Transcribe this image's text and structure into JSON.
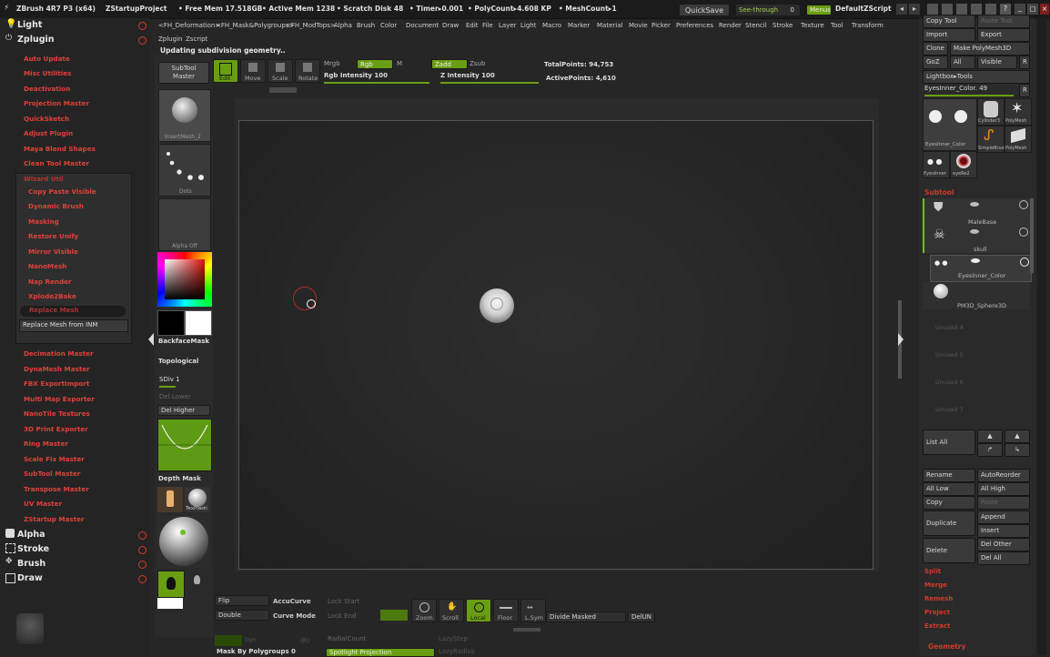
{
  "titlebar": {
    "app": "ZBrush 4R7 P3 (x64)",
    "project": "ZStartupProject",
    "free_mem": "• Free Mem 17.518GB",
    "active_mem": "• Active Mem 1238",
    "scratch": "• Scratch Disk 48",
    "timer": "• Timer▸0.001",
    "polycount": "• PolyCount▸4.608 KP",
    "meshcount": "• MeshCount▸1",
    "quicksave": "QuickSave",
    "seethrough": "See-through",
    "seethrough_val": "0",
    "menus": "Menus",
    "defaultzscript": "DefaultZScript"
  },
  "menubar": [
    "<FH_Deformation>",
    "<FH_Mask&Polygroups>",
    "<FH_ModTops>",
    "Alpha",
    "Brush",
    "Color",
    "Document",
    "Draw",
    "Edit",
    "File",
    "Layer",
    "Light",
    "Macro",
    "Marker",
    "Material",
    "Movie",
    "Picker",
    "Preferences",
    "Render",
    "Stencil",
    "Stroke",
    "Texture",
    "Tool",
    "Transform"
  ],
  "submenubar": [
    "Zplugin",
    "Zscript"
  ],
  "status": "Updating subdivision geometry..",
  "left_panel": {
    "light": "Light",
    "zplugin": "Zplugin",
    "plugins_top": [
      "Auto Update",
      "Misc Utilities",
      "Deactivation",
      "Projection Master",
      "QuickSketch",
      "Adjust Plugin",
      "Maya Blend Shapes",
      "Clean Tool Master"
    ],
    "wizard": "Wizard Util",
    "wizard_items": [
      "Copy Paste Visible",
      "Dynamic Brush",
      "Masking",
      "Restore Unify",
      "Mirror Visible",
      "NanoMesh",
      "Nap Render",
      "Xplode2Bake",
      "Replace Mesh"
    ],
    "replace_mesh_inm": "Replace Mesh from INM",
    "plugins_bottom": [
      "Decimation Master",
      "DynaMesh Master",
      "FBX ExportImport",
      "Multi Map Exporter",
      "NanoTile Textures",
      "3D Print Exporter",
      "Ring Master",
      "Scale Fix Master",
      "SubTool Master",
      "Transpose Master",
      "UV Master",
      "ZStartup Master"
    ],
    "alpha": "Alpha",
    "stroke": "Stroke",
    "brush": "Brush",
    "draw": "Draw"
  },
  "shelf": {
    "subtool_master": [
      "SubTool",
      "Master"
    ],
    "edit": "Edit",
    "move": "Move",
    "scale": "Scale",
    "rotate": "Rotate",
    "mrgb": "Mrgb",
    "rgb": "Rgb",
    "m": "M",
    "zadd": "Zadd",
    "zsub": "Zsub",
    "rgb_intensity": "Rgb Intensity 100",
    "z_intensity": "Z Intensity 100",
    "total_points": "TotalPoints: 94,753",
    "active_points": "ActivePoints: 4,610"
  },
  "left_tray": {
    "brush_label": "InsertMesh_2",
    "stroke_label": "Dots",
    "alpha_label": "Alpha Off",
    "backface": "BackfaceMask",
    "topological": "Topological",
    "sdiv": "SDiv 1",
    "del_lower": "Del Lower",
    "del_higher": "Del Higher",
    "depth_mask": "Depth Mask",
    "texture_label": "TexPlasti"
  },
  "bottom_bar": {
    "flip": "Flip",
    "double": "Double",
    "accucurve": "AccuCurve",
    "curve_mode": "Curve Mode",
    "lock_start": "Lock Start",
    "lock_end": "Lock End",
    "zoom": "Zoom",
    "scroll": "Scroll",
    "local": "Local",
    "floor": "Floor",
    "lsym": "L.Sym",
    "divide_masked": "Divide Masked",
    "delun": "DelUN",
    "radialcount": "RadialCount",
    "lazystep": "LazyStep",
    "mask_by_polygroups": "Mask By Polygroups 0",
    "spotlight": "Spotlight Projection",
    "lazyradius": "LazyRadius",
    "dyn": "Dyn",
    "r": "(R)"
  },
  "right_panel": {
    "copy_tool": "Copy Tool",
    "paste_tool": "Paste Tool",
    "import": "Import",
    "export": "Export",
    "clone": "Clone",
    "make_polymesh": "Make PolyMesh3D",
    "goz": "GoZ",
    "all": "All",
    "visible": "Visible",
    "r": "R",
    "lightbox_tools": "Lightbox▸Tools",
    "current_tool": "EyesInner_Color. 49",
    "tool_thumbs": [
      "EyesInner_Color",
      "Cylinder3",
      "PolyMesh",
      "SimpleBrush",
      "PolyMesh",
      "EyesInner",
      "eyeRe2"
    ],
    "subtool_header": "Subtool",
    "subtools": [
      "MaleBase",
      "skull",
      "EyesInner_Color",
      "PM3D_Sphere3D",
      "Unused 4",
      "Unused 5",
      "Unused 6",
      "Unused 7"
    ],
    "list_all": "List All",
    "rename": "Rename",
    "autoreorder": "AutoReorder",
    "all_low": "All Low",
    "all_high": "All High",
    "copy": "Copy",
    "paste": "Paste",
    "duplicate": "Duplicate",
    "append": "Append",
    "insert": "Insert",
    "delete": "Delete",
    "del_other": "Del Other",
    "del_all": "Del All",
    "split": "Split",
    "merge": "Merge",
    "remesh": "Remesh",
    "project": "Project",
    "extract": "Extract",
    "geometry": "Geometry"
  },
  "colors": {
    "accent_green": "#6a9e12",
    "plugin_red": "#e0413a",
    "background": "#262626"
  }
}
